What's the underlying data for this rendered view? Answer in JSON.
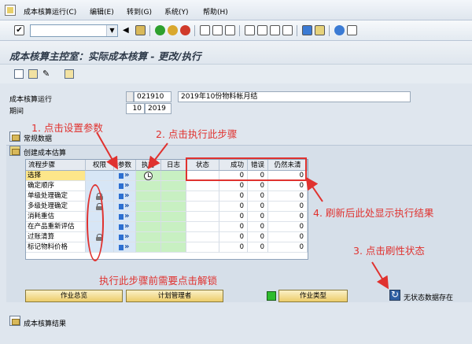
{
  "menu": {
    "items": [
      "成本核算运行(C)",
      "编辑(E)",
      "转到(G)",
      "系统(Y)",
      "帮助(H)"
    ]
  },
  "header": {
    "title": "成本核算主控室：实际成本核算 - 更改/执行"
  },
  "fields": {
    "run_label": "成本核算运行",
    "run_id": "021910",
    "run_desc": "2019年10份物料帐月结",
    "period_label": "期间",
    "period_month": "10",
    "period_year": "2019"
  },
  "sections": {
    "general": "常规数据",
    "create": "创建成本估算",
    "results": "成本核算结果"
  },
  "grid": {
    "columns": [
      "流程步骤",
      "权限",
      "参数",
      "执行",
      "日志",
      "状态",
      "成功",
      "错误",
      "仍然未清"
    ],
    "rows": [
      {
        "step": "选择",
        "locked": false,
        "exec": true,
        "ok": "0",
        "err": "0",
        "open": "0"
      },
      {
        "step": "确定顺序",
        "locked": false,
        "exec": false,
        "ok": "0",
        "err": "0",
        "open": "0"
      },
      {
        "step": "单级处理确定",
        "locked": true,
        "exec": false,
        "ok": "0",
        "err": "0",
        "open": "0"
      },
      {
        "step": "多级处理确定",
        "locked": true,
        "exec": false,
        "ok": "0",
        "err": "0",
        "open": "0"
      },
      {
        "step": "消耗重估",
        "locked": false,
        "exec": false,
        "ok": "0",
        "err": "0",
        "open": "0"
      },
      {
        "step": "在产品重新评估",
        "locked": false,
        "exec": false,
        "ok": "0",
        "err": "0",
        "open": "0"
      },
      {
        "step": "过账清算",
        "locked": true,
        "exec": false,
        "ok": "0",
        "err": "0",
        "open": "0"
      },
      {
        "step": "标记物料价格",
        "locked": false,
        "exec": false,
        "ok": "0",
        "err": "0",
        "open": "0"
      }
    ]
  },
  "buttons": {
    "job_overview": "作业总览",
    "plan_manager": "计划管理者",
    "job_type": "作业类型",
    "no_status": "无状态数据存在"
  },
  "annotations": {
    "a1": "1. 点击设置参数",
    "a2": "2. 点击执行此步骤",
    "a3": "3. 点击刷性状态",
    "a4": "4. 刷新后此处显示执行结果",
    "a5": "执行此步骤前需要点击解锁"
  },
  "colors": {
    "annotation": "#e0322f",
    "exec_column": "#c8f0c2",
    "selected_row": "#fde68a"
  }
}
